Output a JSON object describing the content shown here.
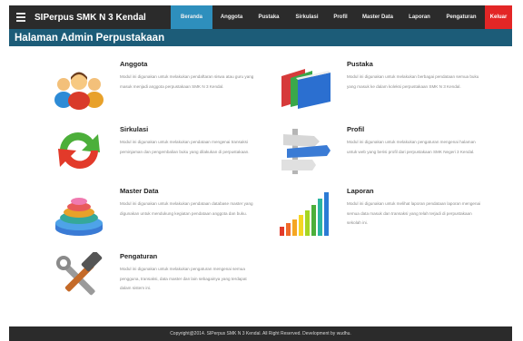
{
  "app": {
    "brand": "SIPerpus SMK N 3 Kendal"
  },
  "nav": {
    "items": [
      {
        "label": "Beranda",
        "active": true
      },
      {
        "label": "Anggota",
        "active": false
      },
      {
        "label": "Pustaka",
        "active": false
      },
      {
        "label": "Sirkulasi",
        "active": false
      },
      {
        "label": "Profil",
        "active": false
      },
      {
        "label": "Master Data",
        "active": false
      },
      {
        "label": "Laporan",
        "active": false
      },
      {
        "label": "Pengaturan",
        "active": false
      }
    ],
    "logout_label": "Keluar"
  },
  "header": {
    "title": "Halaman Admin Perpustakaan"
  },
  "tiles": [
    {
      "title": "Anggota",
      "icon": "users-icon",
      "description": "Modul ini digunakan untuk melakukan pendaftaran siswa atau guru yang masuk menjadi anggota perpustakaan SMK N 3 Kendal."
    },
    {
      "title": "Pustaka",
      "icon": "books-icon",
      "description": "Modul ini digunakan untuk melakukan berbagai pendataan semua buku yang masuk ke dalam koleksi perpustakaan SMK N 3 Kendal."
    },
    {
      "title": "Sirkulasi",
      "icon": "refresh-arrows-icon",
      "description": "Modul ini digunakan untuk melakukan pendataan mengenai transaksi peminjaman dan pengembalian buku yang dilakukan di perpustakaan."
    },
    {
      "title": "Profil",
      "icon": "signpost-icon",
      "description": "Modul ini digunakan untuk melakukan pengaturan mengenai halaman untuk web yang berisi profil dari perpustakaan SMK Negeri 3 Kendal."
    },
    {
      "title": "Master Data",
      "icon": "database-layers-icon",
      "description": "Modul ini digunakan untuk melakukan pendataan database master yang digunakan untuk mendukung kegiatan pendataan anggota dan buku."
    },
    {
      "title": "Laporan",
      "icon": "bar-chart-icon",
      "description": "Modul ini digunakan untuk melihat laporan pendataan laporan mengenai semua data masuk dan transaksi yang telah terjadi di perpustakaan sekolah ini."
    },
    {
      "title": "Pengaturan",
      "icon": "tools-icon",
      "description": "Modul ini digunakan untuk melakukan pengaturan mengenai semua pengguna, transaksi, data master dan lain sebagainya yang terdapat dalam sistem ini."
    }
  ],
  "footer": {
    "text": "Copyright@2014. SIPerpus SMK N 3 Kendal. All Right Reserved. Development by wudhu."
  },
  "colors": {
    "navbar": "#2b2b2b",
    "active_nav": "#2e8fbd",
    "logout": "#e32626",
    "header": "#1c5c78"
  }
}
